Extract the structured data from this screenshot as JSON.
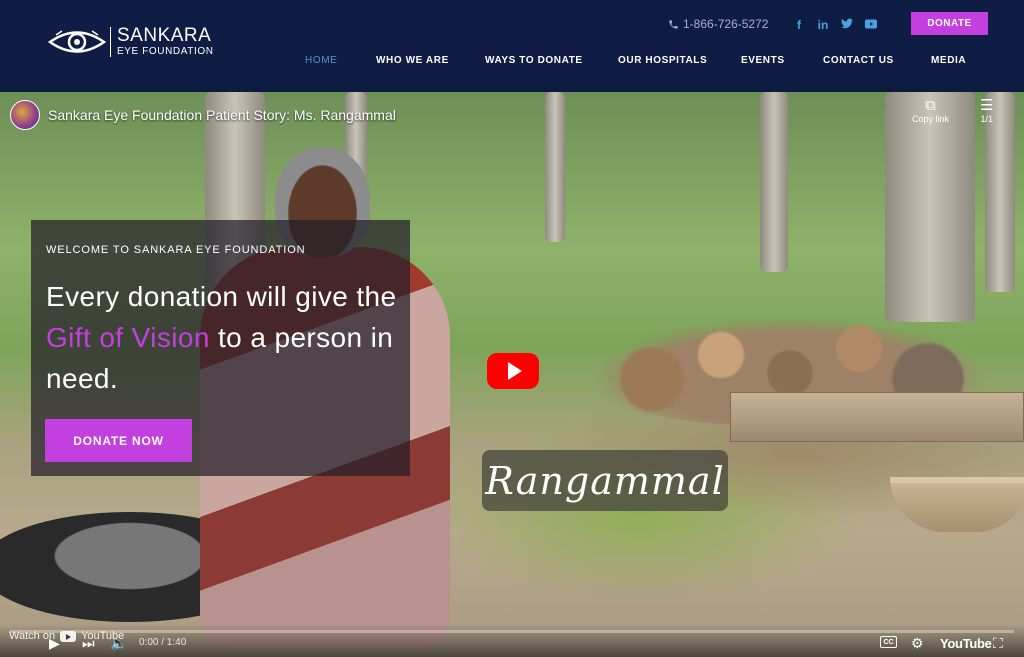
{
  "brand": {
    "name": "SANKARA",
    "subtitle": "EYE FOUNDATION",
    "icon": "eye-logo-icon"
  },
  "header": {
    "phone": "1-866-726-5272",
    "phone_icon": "phone-icon",
    "socials": [
      {
        "name": "facebook",
        "glyph": "f"
      },
      {
        "name": "linkedin",
        "glyph": "in"
      },
      {
        "name": "twitter",
        "glyph": "🐦"
      },
      {
        "name": "youtube",
        "glyph": "▶"
      }
    ],
    "donate_label": "DONATE"
  },
  "nav": {
    "items": [
      {
        "label": "HOME",
        "active": true
      },
      {
        "label": "WHO WE ARE",
        "active": false
      },
      {
        "label": "WAYS TO DONATE",
        "active": false
      },
      {
        "label": "OUR HOSPITALS",
        "active": false
      },
      {
        "label": "EVENTS",
        "active": false
      },
      {
        "label": "CONTACT US",
        "active": false
      },
      {
        "label": "MEDIA",
        "active": false
      }
    ]
  },
  "video": {
    "title": "Sankara Eye Foundation Patient Story: Ms. Rangammal",
    "copy_link_label": "Copy link",
    "playlist_count": "1/1",
    "caption": "Rangammal",
    "watch_on": "Watch on",
    "youtube_label": "YouTube",
    "time": "0:00 / 1:40",
    "youtube_wordmark": "YouTube"
  },
  "hero": {
    "eyebrow": "WELCOME TO SANKARA EYE FOUNDATION",
    "headline_before": "Every donation will give the ",
    "headline_accent": "Gift of Vision",
    "headline_after": " to a person in need.",
    "cta_label": "DONATE NOW"
  },
  "colors": {
    "header_bg": "#0f1d44",
    "accent": "#c33fe0",
    "nav_active": "#5b8fd0",
    "social": "#4aa3e0"
  }
}
